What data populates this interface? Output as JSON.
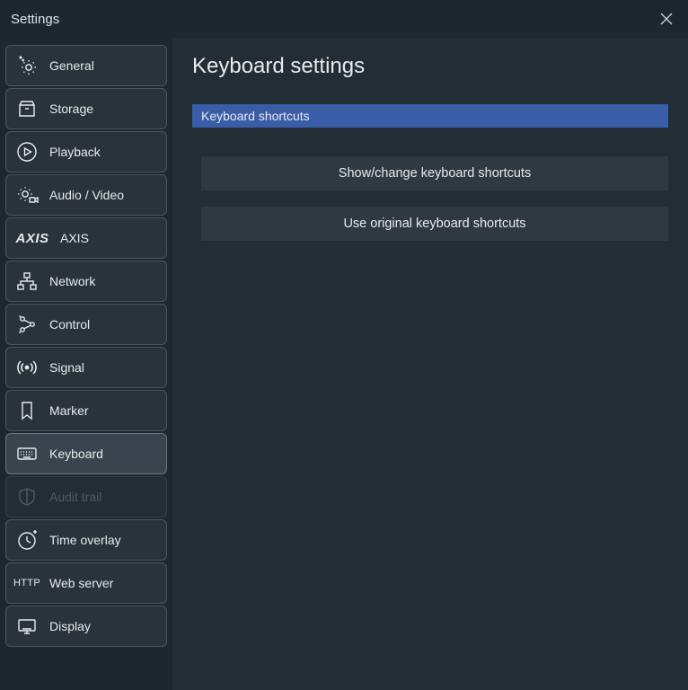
{
  "titlebar": {
    "title": "Settings"
  },
  "sidebar": {
    "items": [
      {
        "label": "General"
      },
      {
        "label": "Storage"
      },
      {
        "label": "Playback"
      },
      {
        "label": "Audio / Video"
      },
      {
        "label": "AXIS"
      },
      {
        "label": "Network"
      },
      {
        "label": "Control"
      },
      {
        "label": "Signal"
      },
      {
        "label": "Marker"
      },
      {
        "label": "Keyboard"
      },
      {
        "label": "Audit trail"
      },
      {
        "label": "Time overlay"
      },
      {
        "label": "Web server"
      },
      {
        "label": "Display"
      }
    ]
  },
  "content": {
    "title": "Keyboard settings",
    "section": "Keyboard shortcuts",
    "btn_show": "Show/change keyboard shortcuts",
    "btn_reset": "Use original keyboard shortcuts"
  },
  "http_label": "HTTP"
}
